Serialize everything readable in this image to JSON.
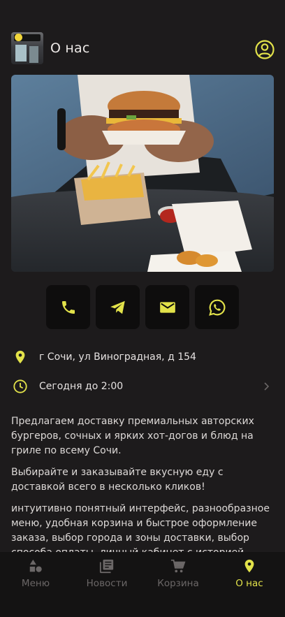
{
  "header": {
    "title": "О нас",
    "logo": "restaurant-logo",
    "profile_icon": "account-circle-icon"
  },
  "hero": {
    "image": "burger-and-fries-photo"
  },
  "contacts": [
    {
      "name": "phone-icon"
    },
    {
      "name": "telegram-icon"
    },
    {
      "name": "email-icon"
    },
    {
      "name": "whatsapp-icon"
    }
  ],
  "info": {
    "address": "г Сочи, ул Виноградная, д 154",
    "hours": "Сегодня до 2:00"
  },
  "description": [
    "Предлагаем доставку премиальных авторских бургеров, сочных и ярких хот-догов и блюд на гриле по всему Сочи.",
    "Выбирайте и заказывайте вкусную еду с доставкой всего в несколько кликов!",
    "интуитивно понятный интерфейс, разнообразное меню, удобная корзина и быстрое оформление заказа, выбор города и зоны доставки, выбор способа оплаты, личный кабинет с историей заказов, бонусы за"
  ],
  "nav": [
    {
      "label": "Меню",
      "icon": "shapes-icon"
    },
    {
      "label": "Новости",
      "icon": "news-icon"
    },
    {
      "label": "Корзина",
      "icon": "cart-icon"
    },
    {
      "label": "О нас",
      "icon": "location-pin-icon",
      "active": true
    }
  ],
  "colors": {
    "accent": "#e2e24a",
    "background": "#1d1b1c",
    "button_bg": "#0e0d0d",
    "nav_bg": "#141313",
    "inactive": "#6b6767"
  }
}
